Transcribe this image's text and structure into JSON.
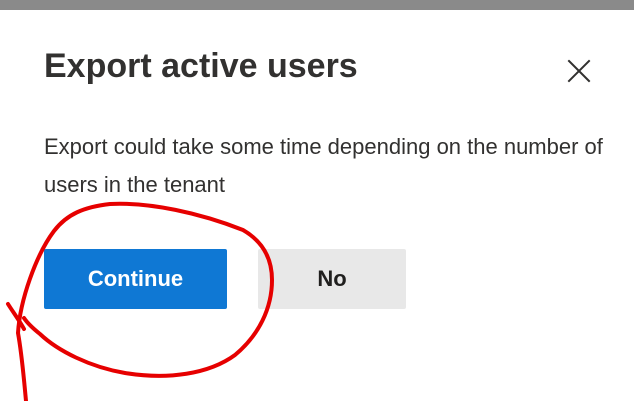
{
  "dialog": {
    "title": "Export active users",
    "message": "Export could take some time depending on the number of users in the tenant",
    "close_icon": "close-icon",
    "buttons": {
      "continue_label": "Continue",
      "no_label": "No"
    }
  },
  "colors": {
    "primary_button": "#0f78d4",
    "secondary_button": "#e8e8e8",
    "annotation": "#e60000",
    "text": "#323130"
  }
}
